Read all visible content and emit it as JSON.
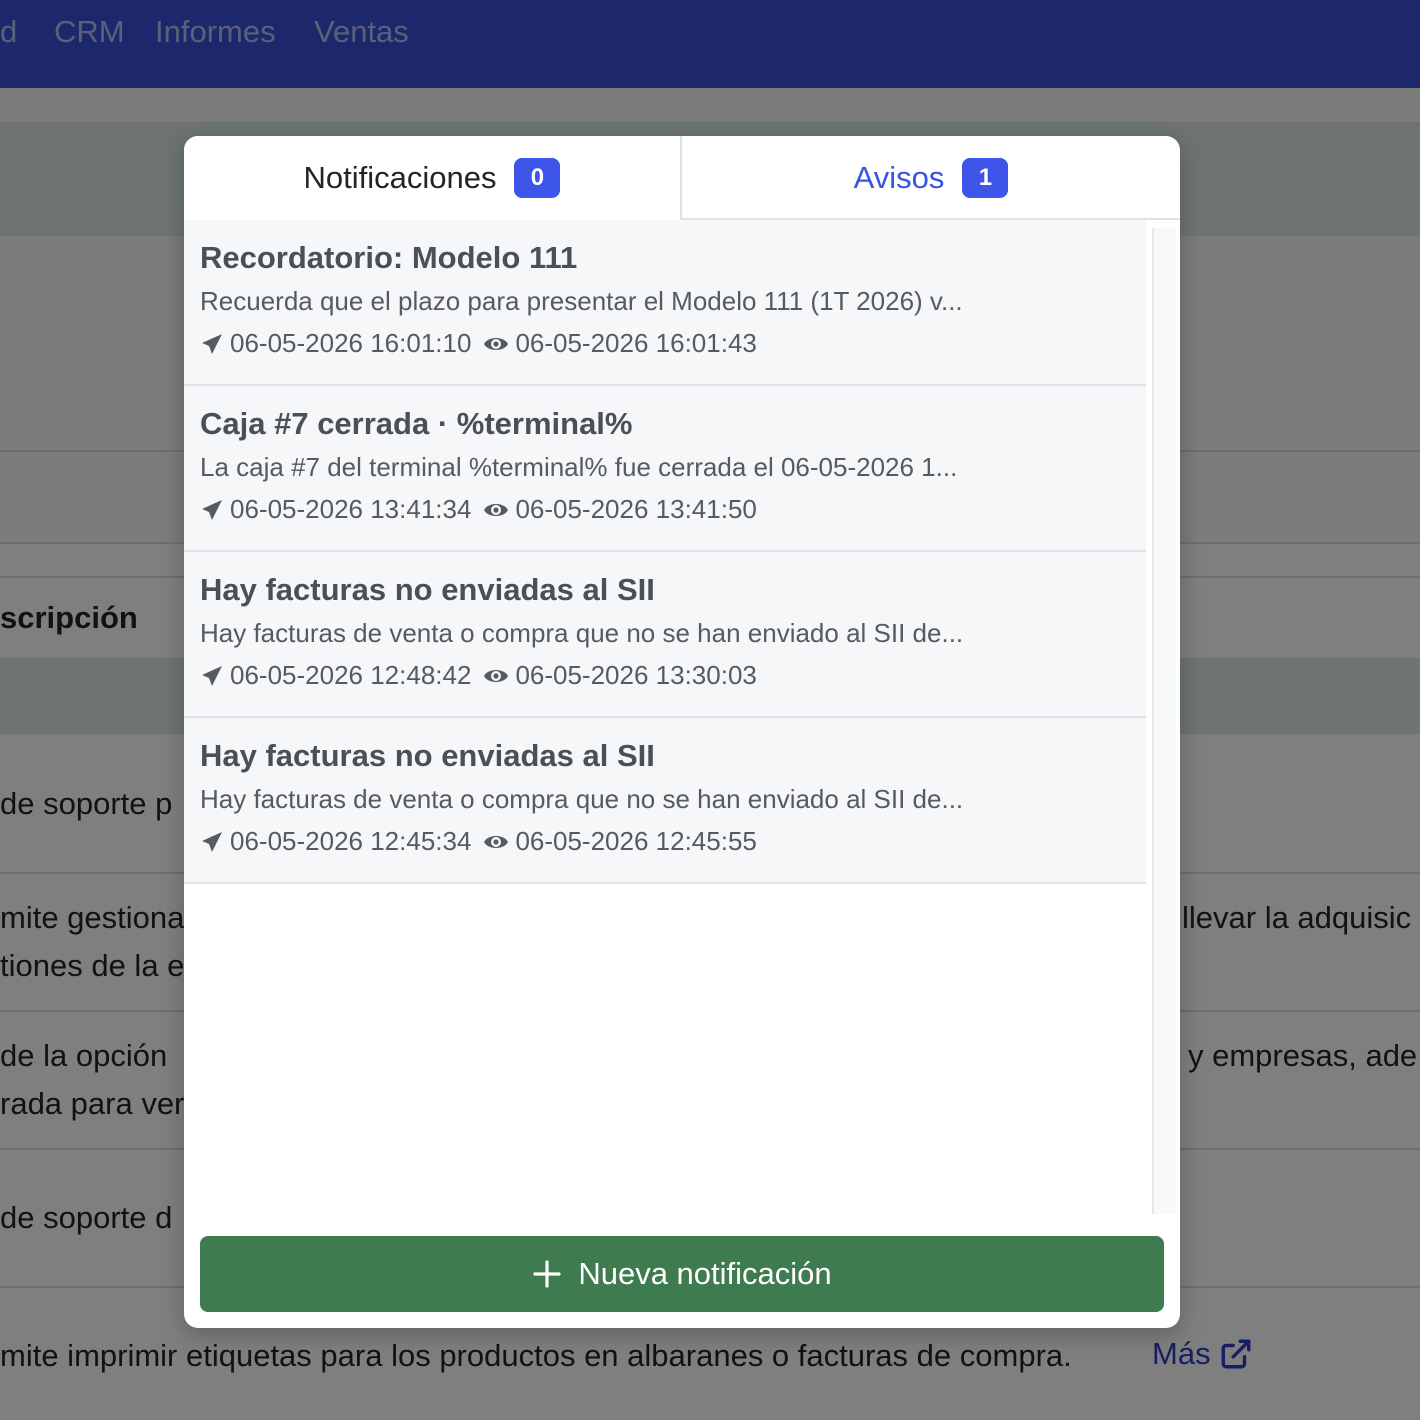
{
  "topbar": {
    "items": [
      "d",
      "CRM",
      "Informes",
      "Ventas"
    ]
  },
  "background": {
    "column_header": "scripción",
    "rows": [
      "de soporte p",
      "mite gestiona",
      "tiones de la e",
      "llevar la adquisic",
      "de la opción",
      "rada para ver",
      "y empresas, ade",
      "de soporte d",
      "mite imprimir etiquetas para los productos en albaranes o facturas de compra."
    ],
    "more_link": "Más"
  },
  "popup": {
    "tabs": [
      {
        "label": "Notificaciones",
        "badge": "0"
      },
      {
        "label": "Avisos",
        "badge": "1"
      }
    ],
    "items": [
      {
        "title": "Recordatorio: Modelo 111",
        "body": "Recuerda que el plazo para presentar el Modelo 111 (1T 2026) v...",
        "sent": "06-05-2026 16:01:10",
        "seen": "06-05-2026 16:01:43"
      },
      {
        "title": "Caja #7 cerrada · %terminal%",
        "body": "La caja #7 del terminal %terminal% fue cerrada el 06-05-2026 1...",
        "sent": "06-05-2026 13:41:34",
        "seen": "06-05-2026 13:41:50"
      },
      {
        "title": "Hay facturas no enviadas al SII",
        "body": "Hay facturas de venta o compra que no se han enviado al SII de...",
        "sent": "06-05-2026 12:48:42",
        "seen": "06-05-2026 13:30:03"
      },
      {
        "title": "Hay facturas no enviadas al SII",
        "body": "Hay facturas de venta o compra que no se han enviado al SII de...",
        "sent": "06-05-2026 12:45:34",
        "seen": "06-05-2026 12:45:55"
      }
    ],
    "new_button": "Nueva notificación"
  },
  "colors": {
    "topbar": "#3a4fd6",
    "accent": "#3d55e8",
    "button": "#3e7b4e"
  },
  "icons": [
    "paper-plane-icon",
    "eye-icon",
    "plus-icon",
    "external-link-icon"
  ]
}
